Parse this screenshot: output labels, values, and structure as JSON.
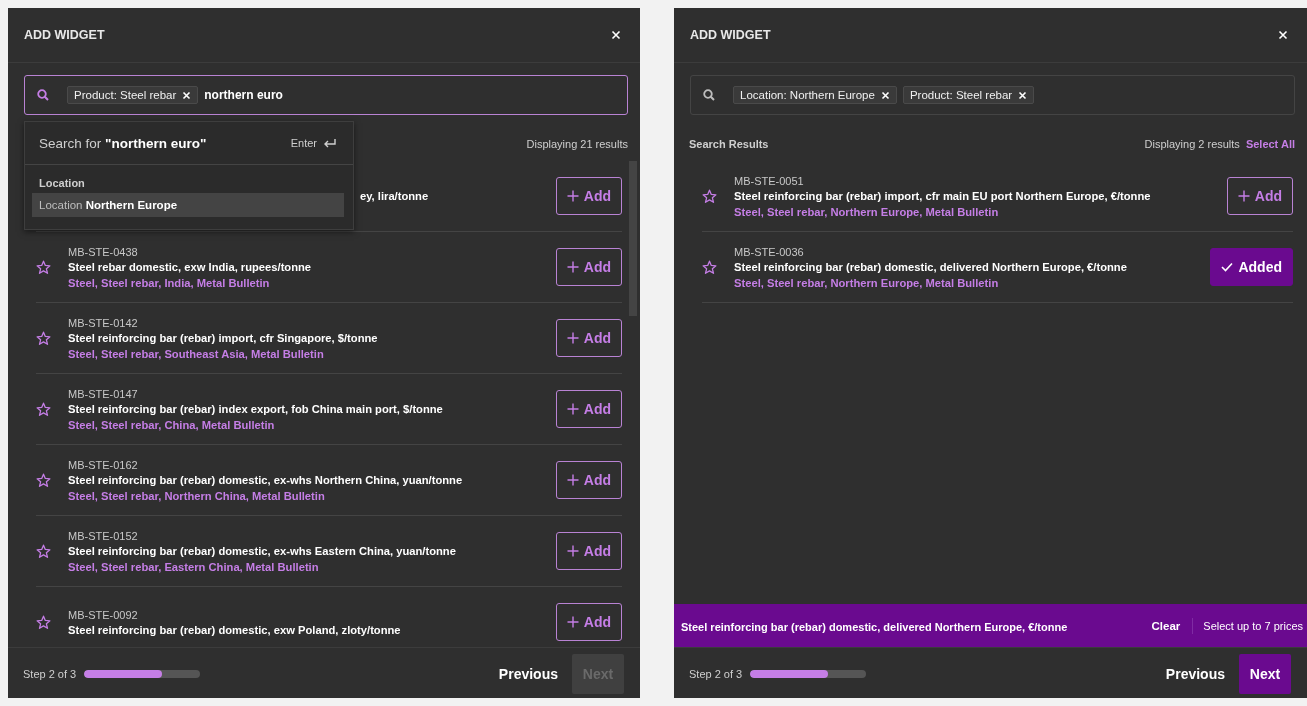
{
  "panels": [
    {
      "title": "ADD WIDGET",
      "search": {
        "focused": true,
        "chips": [
          "Product: Steel rebar"
        ],
        "value": "northern euro"
      },
      "suggestions": {
        "search_text": "Search for **\"northern euro\"**",
        "shortcut": "Enter",
        "group": "Location",
        "items": [
          {
            "category": "Location",
            "value": "Northern Europe",
            "selected": true
          }
        ]
      },
      "results_header": {
        "count": "Displaying 21 results"
      },
      "scrollable": true,
      "results": [
        {
          "kind": "covered",
          "title": "ey, lira/tonne",
          "button": "Add",
          "added": false
        },
        {
          "kind": "full",
          "code": "MB-STE-0438",
          "title": "Steel rebar domestic, exw India, rupees/tonne",
          "tags": "Steel, Steel rebar, India, Metal Bulletin",
          "button": "Add",
          "added": false
        },
        {
          "kind": "full",
          "code": "MB-STE-0142",
          "title": "Steel reinforcing bar (rebar) import, cfr Singapore, $/tonne",
          "tags": "Steel, Steel rebar, Southeast Asia, Metal Bulletin",
          "button": "Add",
          "added": false
        },
        {
          "kind": "full",
          "code": "MB-STE-0147",
          "title": "Steel reinforcing bar (rebar) index export, fob China main port, $/tonne",
          "tags": "Steel, Steel rebar, China, Metal Bulletin",
          "button": "Add",
          "added": false
        },
        {
          "kind": "full",
          "code": "MB-STE-0162",
          "title": "Steel reinforcing bar (rebar) domestic, ex-whs Northern China, yuan/tonne",
          "tags": "Steel, Steel rebar, Northern China, Metal Bulletin",
          "button": "Add",
          "added": false
        },
        {
          "kind": "full",
          "code": "MB-STE-0152",
          "title": "Steel reinforcing bar (rebar) domestic, ex-whs Eastern China, yuan/tonne",
          "tags": "Steel, Steel rebar, Eastern China, Metal Bulletin",
          "button": "Add",
          "added": false
        },
        {
          "kind": "full",
          "code": "MB-STE-0092",
          "title": "Steel reinforcing bar (rebar) domestic, exw Poland, zloty/tonne",
          "button": "Add",
          "added": false
        }
      ],
      "footer": {
        "step": "Step 2 of 3",
        "level": 0.67,
        "previous": "Previous",
        "next": "Next",
        "next_disabled": true
      }
    },
    {
      "title": "ADD WIDGET",
      "search": {
        "focused": false,
        "chips": [
          "Location: Northern Europe",
          "Product: Steel rebar"
        ]
      },
      "results_header": {
        "heading": "Search Results",
        "count": "Displaying 2 results",
        "select_all": "Select All"
      },
      "scrollable": false,
      "results": [
        {
          "kind": "full",
          "code": "MB-STE-0051",
          "title": "Steel reinforcing bar (rebar) import, cfr main EU port Northern Europe, €/tonne",
          "tags": "Steel, Steel rebar, Northern Europe, Metal Bulletin",
          "button": "Add",
          "added": false
        },
        {
          "kind": "full",
          "code": "MB-STE-0036",
          "title": "Steel reinforcing bar (rebar) domestic, delivered Northern Europe, €/tonne",
          "tags": "Steel, Steel rebar, Northern Europe, Metal Bulletin",
          "button": "Added",
          "added": true
        }
      ],
      "selection_bar": {
        "items": [
          "Steel reinforcing bar (rebar) domestic, delivered Northern Europe, €/tonne"
        ],
        "clear": "Clear",
        "limit": "Select up to 7 prices"
      },
      "footer": {
        "step": "Step 2 of 3",
        "level": 0.67,
        "previous": "Previous",
        "next": "Next",
        "next_disabled": false
      }
    }
  ]
}
